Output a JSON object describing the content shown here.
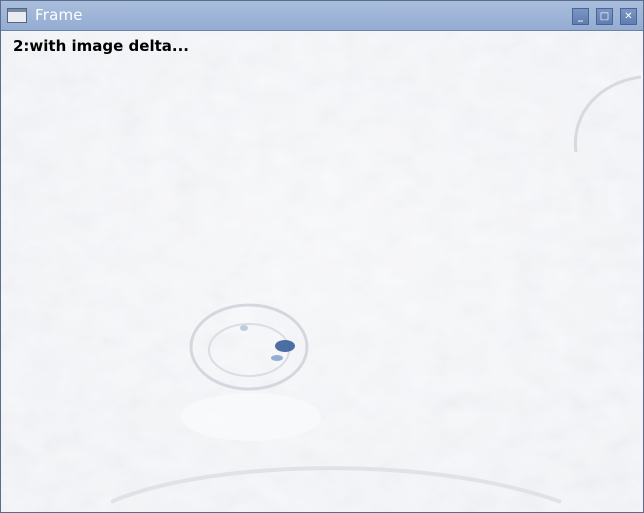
{
  "window": {
    "title": "Frame",
    "icon": "window-icon",
    "buttons": {
      "minimize": "_",
      "maximize": "□",
      "close": "✕"
    }
  },
  "frame": {
    "overlay_text": "2:with image delta..."
  },
  "colors": {
    "titlebar": "#9bb2d6",
    "background": "#f2f3f6",
    "highlight": "#3d5fa0"
  }
}
